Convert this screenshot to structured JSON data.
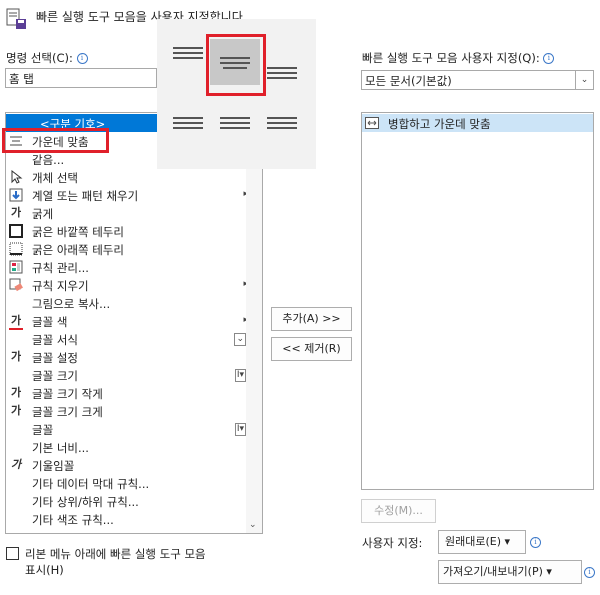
{
  "window": {
    "title": "빠른 실행 도구 모음을 사용자 지정합니다"
  },
  "left": {
    "label": "명령 선택(C):",
    "combo_value": "홈 탭",
    "items": [
      {
        "label": "<구분 기호>",
        "icon": "separator"
      },
      {
        "label": "가운데 맞춤",
        "icon": "align-center-icon"
      },
      {
        "label": "같음...",
        "icon": ""
      },
      {
        "label": "개체 선택",
        "icon": "select-objects-icon"
      },
      {
        "label": "계열 또는 패턴 채우기",
        "icon": "fill-series-icon",
        "sub": "▸"
      },
      {
        "label": "굵게",
        "icon": "bold-icon",
        "glyph": "가"
      },
      {
        "label": "굵은 바깥쪽 테두리",
        "icon": "thick-outside-border-icon"
      },
      {
        "label": "굵은 아래쪽 테두리",
        "icon": "thick-bottom-border-icon"
      },
      {
        "label": "규칙 관리...",
        "icon": "manage-rules-icon"
      },
      {
        "label": "규칙 지우기",
        "icon": "clear-rules-icon",
        "sub": "▸"
      },
      {
        "label": "그림으로 복사...",
        "icon": ""
      },
      {
        "label": "글꼴 색",
        "icon": "font-color-icon",
        "glyph": "가",
        "sub": "▸"
      },
      {
        "label": "글꼴 서식",
        "icon": "",
        "sub": "⌄"
      },
      {
        "label": "글꼴 설정",
        "icon": "font-settings-icon",
        "glyph": "가"
      },
      {
        "label": "글꼴 크기",
        "icon": "",
        "sub": "I▾"
      },
      {
        "label": "글꼴 크기 작게",
        "icon": "decrease-font-icon",
        "glyph": "가"
      },
      {
        "label": "글꼴 크기 크게",
        "icon": "increase-font-icon",
        "glyph": "가"
      },
      {
        "label": "글꼴",
        "icon": "",
        "sub": "I▾"
      },
      {
        "label": "기본 너비...",
        "icon": ""
      },
      {
        "label": "기울임꼴",
        "icon": "italic-icon",
        "glyph": "가"
      },
      {
        "label": "기타 데이터 막대 규칙...",
        "icon": ""
      },
      {
        "label": "기타 상위/하위 규칙...",
        "icon": ""
      },
      {
        "label": "기타 색조 규칙...",
        "icon": ""
      }
    ]
  },
  "right": {
    "label": "빠른 실행 도구 모음 사용자 지정(Q):",
    "combo_value": "모든 문서(기본값)",
    "items": [
      {
        "label": "병합하고 가운데 맞춤",
        "icon": "merge-center-icon"
      }
    ]
  },
  "buttons": {
    "add": "추가(A) >>",
    "remove": "<< 제거(R)",
    "modify": "수정(M)...",
    "reset": "원래대로(E)",
    "import_export": "가져오기/내보내기(P)"
  },
  "customize_label": "사용자 지정:",
  "checkbox": {
    "line1": "리본 메뉴 아래에 빠른 실행 도구 모음",
    "line2": "표시(H)",
    "checked": false
  },
  "accent": "#e0202a",
  "selection": "#0078d7",
  "right_selection": "#cce4f7"
}
